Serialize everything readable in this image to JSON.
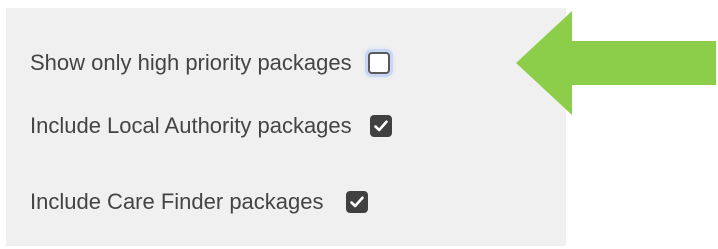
{
  "filters": {
    "options": [
      {
        "label": "Show only high priority packages",
        "checked": false
      },
      {
        "label": "Include Local Authority packages",
        "checked": true
      },
      {
        "label": "Include Care Finder packages",
        "checked": true
      }
    ]
  },
  "annotation": {
    "arrow_color": "#8cce4a"
  }
}
